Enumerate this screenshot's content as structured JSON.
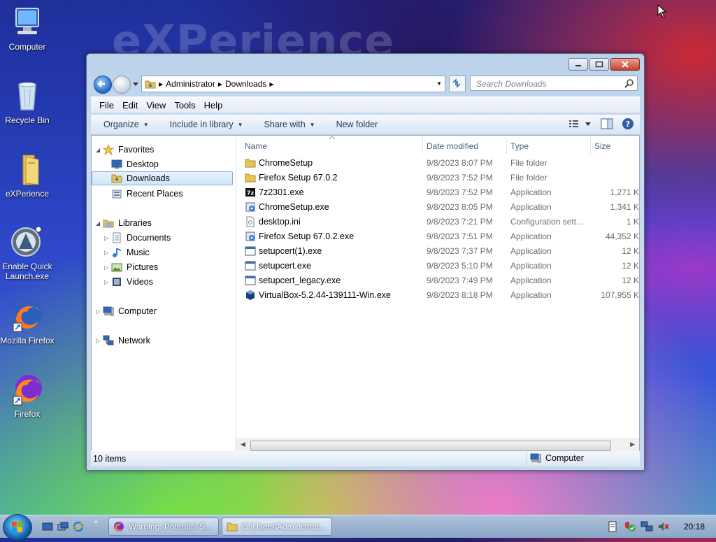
{
  "desktop": {
    "watermark": "eXPerience",
    "icons": [
      {
        "label": "Computer"
      },
      {
        "label": "Recycle Bin"
      },
      {
        "label": "eXPerience"
      },
      {
        "label": "Enable Quick Launch.exe"
      },
      {
        "label": "Mozilla Firefox"
      },
      {
        "label": "Firefox"
      }
    ]
  },
  "window": {
    "address": {
      "crumbs": [
        "Administrator",
        "Downloads"
      ]
    },
    "search_placeholder": "Search Downloads",
    "menu": [
      "File",
      "Edit",
      "View",
      "Tools",
      "Help"
    ],
    "commands": {
      "organize": "Organize",
      "include": "Include in library",
      "share": "Share with",
      "newfolder": "New folder"
    },
    "nav": {
      "favorites": "Favorites",
      "desktop": "Desktop",
      "downloads": "Downloads",
      "recent": "Recent Places",
      "libraries": "Libraries",
      "documents": "Documents",
      "music": "Music",
      "pictures": "Pictures",
      "videos": "Videos",
      "computer": "Computer",
      "network": "Network"
    },
    "columns": {
      "name": "Name",
      "date": "Date modified",
      "type": "Type",
      "size": "Size"
    },
    "files": [
      {
        "name": "ChromeSetup",
        "date": "9/8/2023 8:07 PM",
        "type": "File folder",
        "size": "",
        "icon": "folder-icon"
      },
      {
        "name": "Firefox Setup 67.0.2",
        "date": "9/8/2023 7:52 PM",
        "type": "File folder",
        "size": "",
        "icon": "folder-icon"
      },
      {
        "name": "7z2301.exe",
        "date": "9/8/2023 7:52 PM",
        "type": "Application",
        "size": "1,271 K",
        "icon": "7zip-icon"
      },
      {
        "name": "ChromeSetup.exe",
        "date": "9/8/2023 8:05 PM",
        "type": "Application",
        "size": "1,341 K",
        "icon": "installer-icon"
      },
      {
        "name": "desktop.ini",
        "date": "9/8/2023 7:21 PM",
        "type": "Configuration sett...",
        "size": "1 K",
        "icon": "ini-file-icon"
      },
      {
        "name": "Firefox Setup 67.0.2.exe",
        "date": "9/8/2023 7:51 PM",
        "type": "Application",
        "size": "44,352 K",
        "icon": "installer-icon"
      },
      {
        "name": "setupcert(1).exe",
        "date": "9/8/2023 7:37 PM",
        "type": "Application",
        "size": "12 K",
        "icon": "app-icon"
      },
      {
        "name": "setupcert.exe",
        "date": "9/8/2023 5:10 PM",
        "type": "Application",
        "size": "12 K",
        "icon": "app-icon"
      },
      {
        "name": "setupcert_legacy.exe",
        "date": "9/8/2023 7:49 PM",
        "type": "Application",
        "size": "12 K",
        "icon": "app-icon"
      },
      {
        "name": "VirtualBox-5.2.44-139111-Win.exe",
        "date": "9/8/2023 8:18 PM",
        "type": "Application",
        "size": "107,955 K",
        "icon": "virtualbox-icon"
      }
    ],
    "status": {
      "count": "10 items",
      "location": "Computer"
    }
  },
  "taskbar": {
    "buttons": [
      {
        "label": "Warning: Potential S..."
      },
      {
        "label": "C:\\Users\\Administrat..."
      }
    ],
    "clock": "20:18"
  }
}
